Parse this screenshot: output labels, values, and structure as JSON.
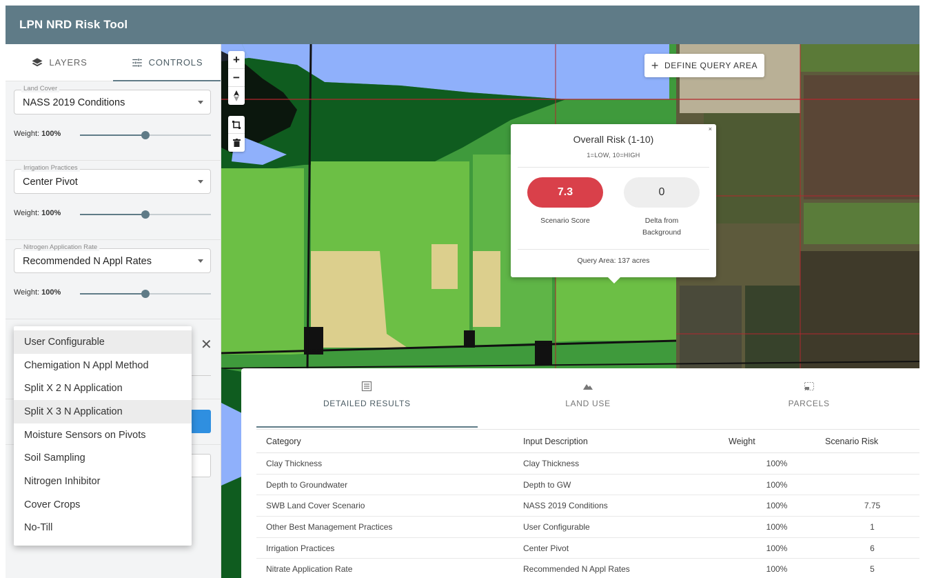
{
  "app": {
    "title": "LPN NRD Risk Tool"
  },
  "sidebar": {
    "tabs": [
      {
        "label": "LAYERS",
        "icon": "layers-icon",
        "active": false
      },
      {
        "label": "CONTROLS",
        "icon": "tune-icon",
        "active": true
      }
    ],
    "controls": [
      {
        "label": "Land Cover",
        "value": "NASS 2019 Conditions",
        "weight_label": "Weight:",
        "weight": "100%",
        "slider_level": 0.5
      },
      {
        "label": "Irrigation Practices",
        "value": "Center Pivot",
        "weight_label": "Weight:",
        "weight": "100%",
        "slider_level": 0.5
      },
      {
        "label": "Nitrogen Application Rate",
        "value": "Recommended N Appl Rates",
        "weight_label": "Weight:",
        "weight": "100%",
        "slider_level": 0.5
      }
    ],
    "bmp_dropdown": {
      "options": [
        "User Configurable",
        "Chemigation N Appl Method",
        "Split X 2 N Application",
        "Split X 3 N Application",
        "Moisture Sensors on Pivots",
        "Soil Sampling",
        "Nitrogen Inhibitor",
        "Cover Crops",
        "No-Till"
      ],
      "highlighted": [
        "User Configurable",
        "Split X 3 N Application"
      ]
    }
  },
  "map": {
    "zoom_in": "+",
    "zoom_out": "−",
    "define_query": "DEFINE QUERY AREA",
    "popup": {
      "title": "Overall Risk (1-10)",
      "subtitle": "1=LOW, 10=HIGH",
      "scenario_score": "7.3",
      "scenario_label": "Scenario Score",
      "delta_value": "0",
      "delta_label_1": "Delta from",
      "delta_label_2": "Background",
      "area": "Query Area: 137 acres",
      "close": "×"
    }
  },
  "results": {
    "tabs": [
      {
        "label": "DETAILED RESULTS",
        "icon": "list-icon",
        "active": true
      },
      {
        "label": "LAND USE",
        "icon": "terrain-icon",
        "active": false
      },
      {
        "label": "PARCELS",
        "icon": "parcel-icon",
        "active": false
      }
    ],
    "columns": [
      "Category",
      "Input Description",
      "Weight",
      "Scenario Risk"
    ],
    "rows": [
      [
        "Clay Thickness",
        "Clay Thickness",
        "100%",
        ""
      ],
      [
        "Depth to Groundwater",
        "Depth to GW",
        "100%",
        ""
      ],
      [
        "SWB Land Cover Scenario",
        "NASS 2019 Conditions",
        "100%",
        "7.75"
      ],
      [
        "Other Best Management Practices",
        "User Configurable",
        "100%",
        "1"
      ],
      [
        "Irrigation Practices",
        "Center Pivot",
        "100%",
        "6"
      ],
      [
        "Nitrate Application Rate",
        "Recommended N Appl Rates",
        "100%",
        "5"
      ]
    ]
  },
  "colors": {
    "header": "#5f7b87",
    "score_red": "#d9404a",
    "water": "#8fb0fb",
    "forest": "#0f5c1f",
    "crop_light": "#6cbf45",
    "crop_bright": "#3f9a3c",
    "fallow": "#dccf8d"
  }
}
